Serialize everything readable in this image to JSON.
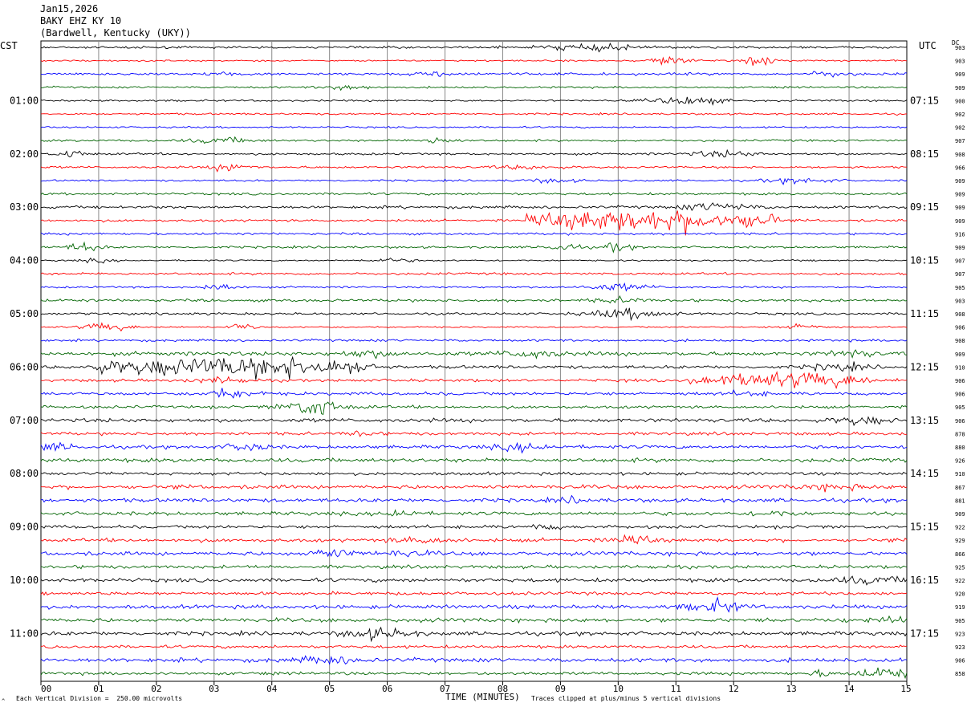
{
  "header": {
    "date": "Jan15,2026",
    "station": "BAKY EHZ KY 10",
    "location": "(Bardwell, Kentucky (UKY))"
  },
  "labels": {
    "left_tz": "CST",
    "right_tz": "UTC",
    "dc": "DC",
    "xlabel": "TIME (MINUTES)",
    "scale_note": "Each Vertical Division =  250.00 microvolts",
    "clip_note": "Traces clipped at plus/minus 5 vertical divisions",
    "corner_mark": "^"
  },
  "chart_data": {
    "type": "line",
    "xlim": [
      0,
      15
    ],
    "x_ticks": [
      "00",
      "01",
      "02",
      "03",
      "04",
      "05",
      "06",
      "07",
      "08",
      "09",
      "10",
      "11",
      "12",
      "13",
      "14",
      "15"
    ],
    "left_hour_labels": [
      "01:00",
      "02:00",
      "03:00",
      "04:00",
      "05:00",
      "06:00",
      "07:00",
      "08:00",
      "09:00",
      "10:00",
      "11:00"
    ],
    "right_hour_labels": [
      "07:15",
      "08:15",
      "09:15",
      "10:15",
      "11:15",
      "12:15",
      "13:15",
      "14:15",
      "15:15",
      "16:15",
      "17:15"
    ],
    "trace_colors": [
      "#000000",
      "#ff0000",
      "#0000ff",
      "#006400"
    ],
    "trace_count": 48,
    "dc_offsets": [
      "903",
      "903",
      "909",
      "909",
      "900",
      "902",
      "902",
      "907",
      "908",
      "966",
      "909",
      "909",
      "909",
      "909",
      "916",
      "909",
      "907",
      "907",
      "905",
      "903",
      "908",
      "906",
      "908",
      "909",
      "910",
      "906",
      "906",
      "905",
      "906",
      "878",
      "880",
      "926",
      "910",
      "867",
      "881",
      "909",
      "922",
      "929",
      "866",
      "925",
      "922",
      "920",
      "919",
      "905",
      "923",
      "923",
      "906",
      "858"
    ],
    "notable_events": [
      {
        "row": 13,
        "start_min": 8.4,
        "end_min": 12.8,
        "amplitude": 1.0
      },
      {
        "row": 24,
        "start_min": 0.8,
        "end_min": 5.9,
        "amplitude": 0.8
      },
      {
        "row": 25,
        "start_min": 11.2,
        "end_min": 14.4,
        "amplitude": 0.6
      }
    ]
  }
}
